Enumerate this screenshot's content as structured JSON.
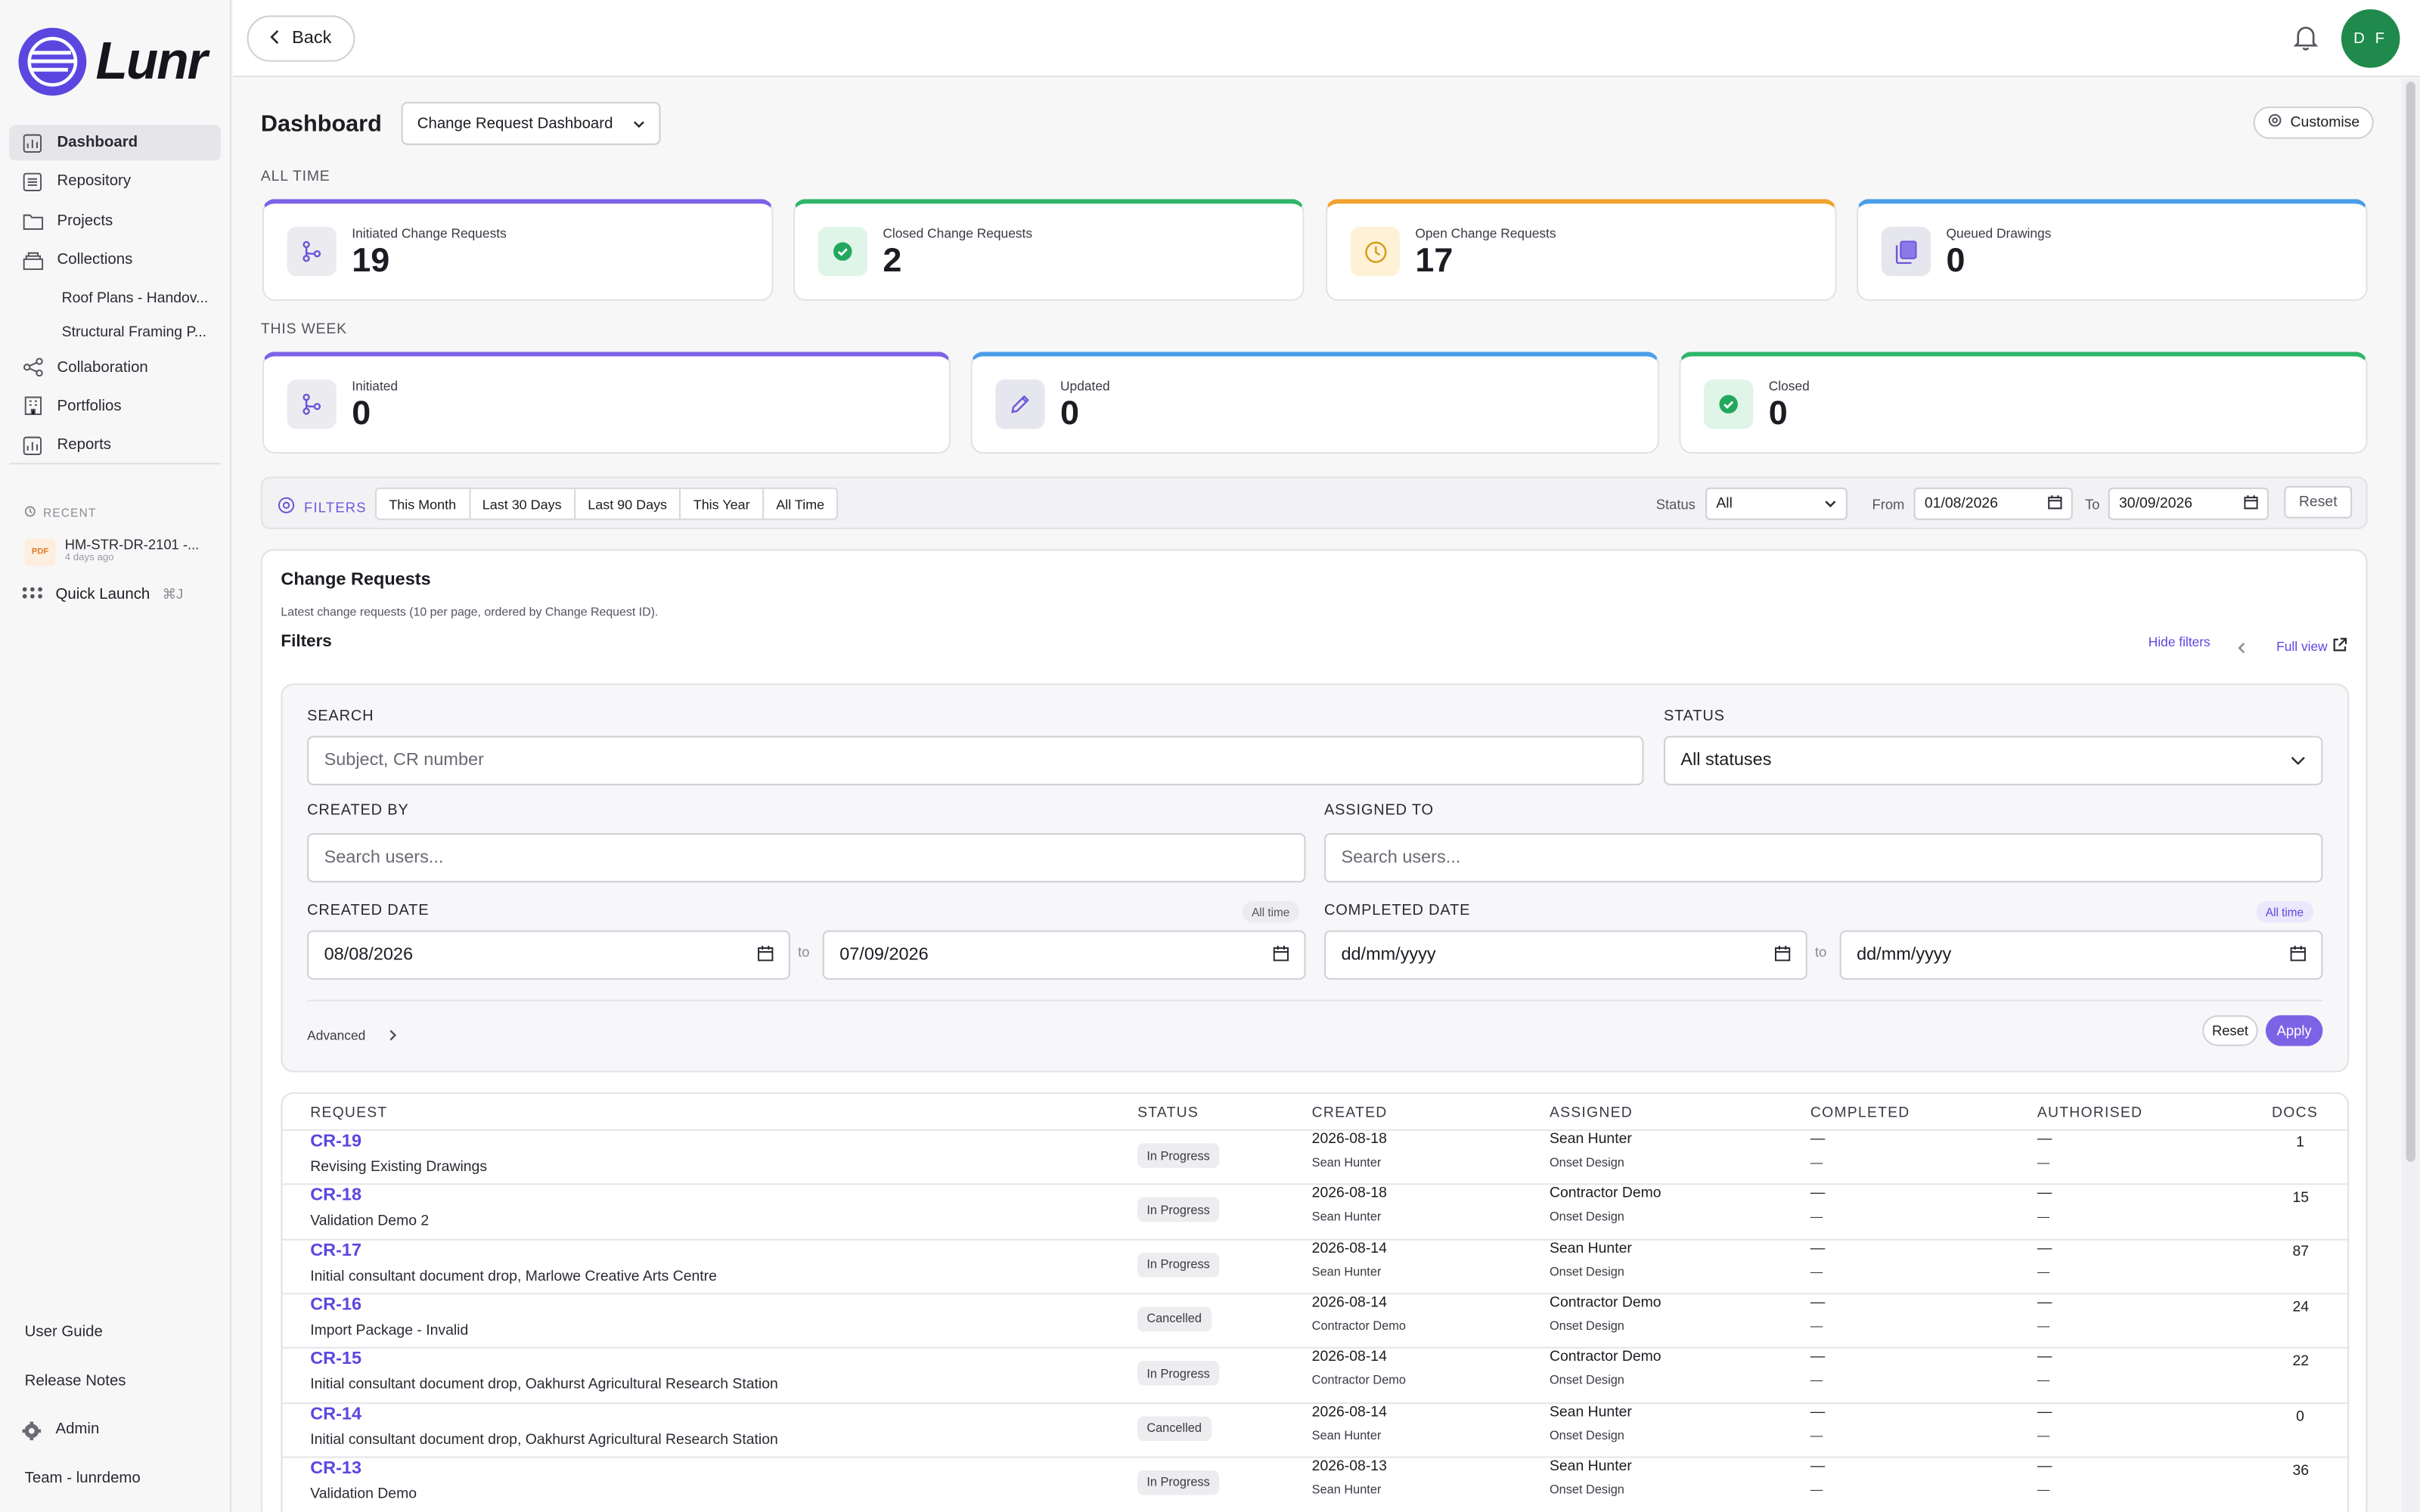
{
  "app": {
    "logo_text": "Lunr",
    "user_initials": "D F"
  },
  "topbar": {
    "back_label": "Back"
  },
  "sidebar": {
    "items": [
      {
        "label": "Dashboard",
        "icon": "chart-icon"
      },
      {
        "label": "Repository",
        "icon": "archive-icon"
      },
      {
        "label": "Projects",
        "icon": "folder-icon"
      },
      {
        "label": "Collections",
        "icon": "stack-icon"
      }
    ],
    "sub_items": [
      "Roof Plans - Handov...",
      "Structural Framing P..."
    ],
    "items2": [
      {
        "label": "Collaboration",
        "icon": "share-icon"
      },
      {
        "label": "Portfolios",
        "icon": "building-icon"
      },
      {
        "label": "Reports",
        "icon": "chart-icon"
      }
    ],
    "recent_label": "RECENT",
    "recent_item": {
      "badge": "PDF",
      "name": "HM-STR-DR-2101 -...",
      "time": "4 days ago"
    },
    "quick_launch": {
      "label": "Quick Launch",
      "shortcut": "⌘J"
    },
    "bottom": [
      "User Guide",
      "Release Notes",
      "Admin",
      "Team - lunrdemo"
    ]
  },
  "header": {
    "title": "Dashboard",
    "dashboard_select": "Change Request Dashboard",
    "customise_label": "Customise"
  },
  "all_time": {
    "label": "ALL TIME",
    "stats": [
      {
        "label": "Initiated Change Requests",
        "value": "19",
        "color": "#7c63e6"
      },
      {
        "label": "Closed Change Requests",
        "value": "2",
        "color": "#2fb56a"
      },
      {
        "label": "Open Change Requests",
        "value": "17",
        "color": "#f0a22a"
      },
      {
        "label": "Queued Drawings",
        "value": "0",
        "color": "#4a9ee8"
      }
    ]
  },
  "this_week": {
    "label": "THIS WEEK",
    "stats": [
      {
        "label": "Initiated",
        "value": "0",
        "color": "#7c63e6"
      },
      {
        "label": "Updated",
        "value": "0",
        "color": "#4a9ee8"
      },
      {
        "label": "Closed",
        "value": "0",
        "color": "#2fb56a"
      }
    ]
  },
  "filters_bar": {
    "label": "FILTERS",
    "chips": [
      "This Month",
      "Last 30 Days",
      "Last 90 Days",
      "This Year",
      "All Time"
    ],
    "status_label": "Status",
    "status_value": "All",
    "from_label": "From",
    "from_value": "01/08/2026",
    "to_label": "To",
    "to_value": "30/09/2026",
    "reset_label": "Reset"
  },
  "change_requests": {
    "title": "Change Requests",
    "subtitle": "Latest change requests (10 per page, ordered by Change Request ID).",
    "filters_title": "Filters",
    "hide_filters": "Hide filters",
    "full_view": "Full view",
    "search_label": "SEARCH",
    "search_placeholder": "Subject, CR number",
    "status_label": "STATUS",
    "status_value": "All statuses",
    "created_by_label": "CREATED BY",
    "created_by_placeholder": "Search users...",
    "assigned_to_label": "ASSIGNED TO",
    "assigned_to_placeholder": "Search users...",
    "created_date_label": "CREATED DATE",
    "created_pill": "All time",
    "created_from": "08/08/2026",
    "created_to": "07/09/2026",
    "completed_date_label": "COMPLETED DATE",
    "completed_pill": "All time",
    "completed_from": "dd/mm/yyyy",
    "completed_to": "dd/mm/yyyy",
    "to_word": "to",
    "advanced_label": "Advanced",
    "reset_label": "Reset",
    "apply_label": "Apply"
  },
  "table": {
    "columns": [
      "REQUEST",
      "STATUS",
      "CREATED",
      "ASSIGNED",
      "COMPLETED",
      "AUTHORISED",
      "DOCS"
    ],
    "rows": [
      {
        "id": "CR-19",
        "subject": "Revising Existing Drawings",
        "status": "In Progress",
        "created": "2026-08-18",
        "created_by": "Sean Hunter",
        "assigned": "Sean Hunter",
        "assigned_org": "Onset Design",
        "completed": "—",
        "completed2": "—",
        "authorised": "—",
        "authorised2": "—",
        "docs": "1"
      },
      {
        "id": "CR-18",
        "subject": "Validation Demo 2",
        "status": "In Progress",
        "created": "2026-08-18",
        "created_by": "Sean Hunter",
        "assigned": "Contractor Demo",
        "assigned_org": "Onset Design",
        "completed": "—",
        "completed2": "—",
        "authorised": "—",
        "authorised2": "—",
        "docs": "15"
      },
      {
        "id": "CR-17",
        "subject": "Initial consultant document drop, Marlowe Creative Arts Centre",
        "status": "In Progress",
        "created": "2026-08-14",
        "created_by": "Sean Hunter",
        "assigned": "Sean Hunter",
        "assigned_org": "Onset Design",
        "completed": "—",
        "completed2": "—",
        "authorised": "—",
        "authorised2": "—",
        "docs": "87"
      },
      {
        "id": "CR-16",
        "subject": "Import Package - Invalid",
        "status": "Cancelled",
        "created": "2026-08-14",
        "created_by": "Contractor Demo",
        "assigned": "Contractor Demo",
        "assigned_org": "Onset Design",
        "completed": "—",
        "completed2": "—",
        "authorised": "—",
        "authorised2": "—",
        "docs": "24"
      },
      {
        "id": "CR-15",
        "subject": "Initial consultant document drop, Oakhurst Agricultural Research Station",
        "status": "In Progress",
        "created": "2026-08-14",
        "created_by": "Contractor Demo",
        "assigned": "Contractor Demo",
        "assigned_org": "Onset Design",
        "completed": "—",
        "completed2": "—",
        "authorised": "—",
        "authorised2": "—",
        "docs": "22"
      },
      {
        "id": "CR-14",
        "subject": "Initial consultant document drop, Oakhurst Agricultural Research Station",
        "status": "Cancelled",
        "created": "2026-08-14",
        "created_by": "Sean Hunter",
        "assigned": "Sean Hunter",
        "assigned_org": "Onset Design",
        "completed": "—",
        "completed2": "—",
        "authorised": "—",
        "authorised2": "—",
        "docs": "0"
      },
      {
        "id": "CR-13",
        "subject": "Validation Demo",
        "status": "In Progress",
        "created": "2026-08-13",
        "created_by": "Sean Hunter",
        "assigned": "Sean Hunter",
        "assigned_org": "Onset Design",
        "completed": "—",
        "completed2": "—",
        "authorised": "—",
        "authorised2": "—",
        "docs": "36"
      }
    ]
  }
}
